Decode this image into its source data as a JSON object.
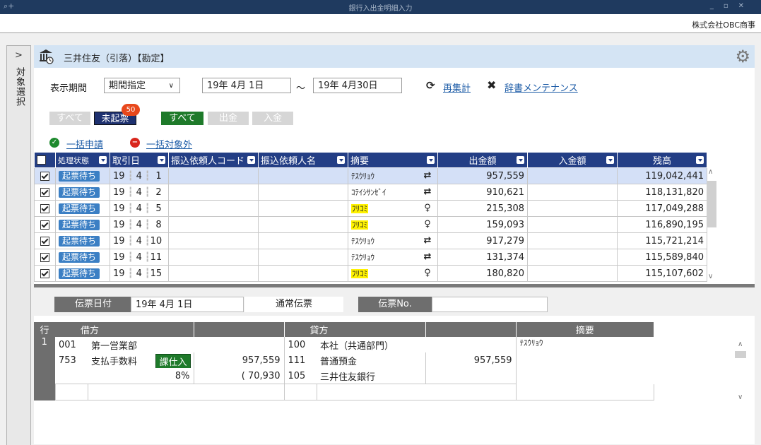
{
  "window": {
    "title": "銀行入出金明細入力",
    "company": "株式会社OBC商事",
    "controls": [
      "_",
      "▫",
      "✕"
    ]
  },
  "side_tab": {
    "chevron": ">",
    "label": "対象選択"
  },
  "header": {
    "title": "三井住友（引落）【勘定】"
  },
  "period": {
    "label": "表示期間",
    "mode": "期間指定",
    "from": "19年 4月 1日",
    "separator": "～",
    "to": "19年 4月30日",
    "recalc_label": "再集計",
    "dict_label": "辞書メンテナンス"
  },
  "filters": {
    "all1": "すべて",
    "unposted": "未起票",
    "unposted_count": "50",
    "all2": "すべて",
    "withdraw": "出金",
    "deposit": "入金"
  },
  "actions": {
    "bulk_apply": "一括申請",
    "bulk_exclude": "一括対象外"
  },
  "grid": {
    "columns": [
      "処理状態",
      "取引日",
      "振込依頼人コード",
      "振込依頼人名",
      "摘要",
      "出金額",
      "入金額",
      "残高"
    ],
    "rows": [
      {
        "checked": true,
        "status": "起票待ち",
        "yy": "19",
        "mm": "4",
        "dd": "1",
        "code": "",
        "name": "",
        "summary": "ﾃｽｳﾘｮｳ",
        "highlight": false,
        "icon": "repeat",
        "out": "957,559",
        "in": "",
        "balance": "119,042,441"
      },
      {
        "checked": true,
        "status": "起票待ち",
        "yy": "19",
        "mm": "4",
        "dd": "2",
        "code": "",
        "name": "",
        "summary": "ｺﾃｲｼｻﾝｾﾞｲ",
        "highlight": false,
        "icon": "repeat",
        "out": "910,621",
        "in": "",
        "balance": "118,131,820"
      },
      {
        "checked": true,
        "status": "起票待ち",
        "yy": "19",
        "mm": "4",
        "dd": "5",
        "code": "",
        "name": "",
        "summary": "ﾌﾘｺﾐ",
        "highlight": true,
        "icon": "bulb",
        "out": "215,308",
        "in": "",
        "balance": "117,049,288"
      },
      {
        "checked": true,
        "status": "起票待ち",
        "yy": "19",
        "mm": "4",
        "dd": "8",
        "code": "",
        "name": "",
        "summary": "ﾌﾘｺﾐ",
        "highlight": true,
        "icon": "bulb",
        "out": "159,093",
        "in": "",
        "balance": "116,890,195"
      },
      {
        "checked": true,
        "status": "起票待ち",
        "yy": "19",
        "mm": "4",
        "dd": "10",
        "code": "",
        "name": "",
        "summary": "ﾃｽｳﾘｮｳ",
        "highlight": false,
        "icon": "repeat",
        "out": "917,279",
        "in": "",
        "balance": "115,721,214"
      },
      {
        "checked": true,
        "status": "起票待ち",
        "yy": "19",
        "mm": "4",
        "dd": "11",
        "code": "",
        "name": "",
        "summary": "ﾃｽｳﾘｮｳ",
        "highlight": false,
        "icon": "repeat",
        "out": "131,374",
        "in": "",
        "balance": "115,589,840"
      },
      {
        "checked": true,
        "status": "起票待ち",
        "yy": "19",
        "mm": "4",
        "dd": "15",
        "code": "",
        "name": "",
        "summary": "ﾌﾘｺﾐ",
        "highlight": true,
        "icon": "bulb",
        "out": "180,820",
        "in": "",
        "balance": "115,107,602"
      }
    ]
  },
  "slip": {
    "date_label": "伝票日付",
    "date_value": "19年 4月 1日",
    "type": "通常伝票",
    "no_label": "伝票No.",
    "no_value": ""
  },
  "journal": {
    "headers": {
      "row": "行",
      "debit": "借方",
      "credit": "貸方",
      "memo": "摘要"
    },
    "row_no": "1",
    "debit_dept_code": "001",
    "debit_dept": "第一営業部",
    "debit_acct_code": "753",
    "debit_acct": "支払手数料",
    "tax_badge": "課仕入",
    "tax_rate": "8%",
    "debit_amount": "957,559",
    "debit_tax": "( 70,930",
    "credit_dept_code": "100",
    "credit_dept": "本社（共通部門）",
    "credit_acct_code": "111",
    "credit_acct": "普通預金",
    "credit_sub_code": "105",
    "credit_sub": "三井住友銀行",
    "credit_amount": "957,559",
    "memo": "ﾃｽｳﾘｮｳ"
  }
}
